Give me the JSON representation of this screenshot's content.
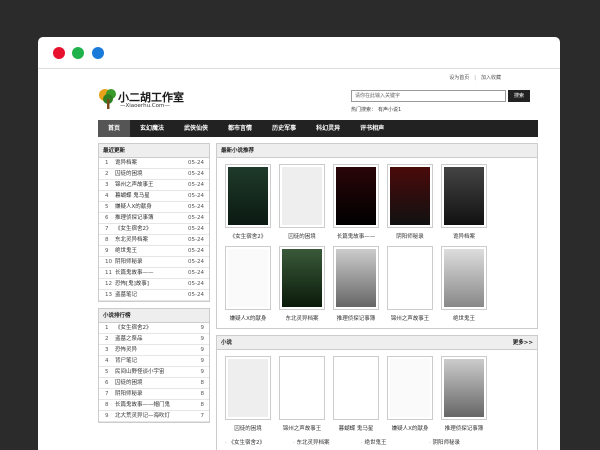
{
  "window": {
    "controls": [
      "close",
      "minimize",
      "maximize"
    ]
  },
  "toplinks": {
    "home": "设为首页",
    "sep": "|",
    "fav": "加入收藏"
  },
  "logo": {
    "cn": "小二胡工作室",
    "en": "—Xiaoerhu.Com—"
  },
  "search": {
    "placeholder": "请你在此输入关键字",
    "button": "搜索",
    "hot_label": "热门搜索：",
    "hot_link": "有声小说1"
  },
  "nav": [
    "首页",
    "玄幻魔法",
    "武侠仙侠",
    "都市言情",
    "历史军事",
    "科幻灵异",
    "评书相声"
  ],
  "latest": {
    "title": "最近更新",
    "items": [
      {
        "t": "诡异档案",
        "d": "05-24"
      },
      {
        "t": "囚徒的困境",
        "d": "05-24"
      },
      {
        "t": "锦州之声故事王",
        "d": "05-24"
      },
      {
        "t": "暮蝴蝶 鬼马星",
        "d": "05-24"
      },
      {
        "t": "嫌疑人X的献身",
        "d": "05-24"
      },
      {
        "t": "推理侦探记事簿",
        "d": "05-24"
      },
      {
        "t": "《女生宿舍2》",
        "d": "05-24"
      },
      {
        "t": "东北灵异档案",
        "d": "05-24"
      },
      {
        "t": "绝世鬼王",
        "d": "05-24"
      },
      {
        "t": "阴阳师秘录",
        "d": "05-24"
      },
      {
        "t": "长篇鬼故事——",
        "d": "05-24"
      },
      {
        "t": "恐怖[鬼]故事]",
        "d": "05-24"
      },
      {
        "t": "盗墓笔记",
        "d": "05-24"
      }
    ]
  },
  "ranking": {
    "title": "小说排行榜",
    "items": [
      {
        "n": "1",
        "t": "《女生宿舍2》",
        "v": "9"
      },
      {
        "n": "2",
        "t": "盗墓之祭品",
        "v": "9"
      },
      {
        "n": "3",
        "t": "恐怖灵异",
        "v": "9"
      },
      {
        "n": "4",
        "t": "背尸笔记",
        "v": "9"
      },
      {
        "n": "5",
        "t": "民间山野怪谈小宇宙",
        "v": "9"
      },
      {
        "n": "6",
        "t": "囚徒的困境",
        "v": "8"
      },
      {
        "n": "7",
        "t": "阴阳师秘录",
        "v": "8"
      },
      {
        "n": "8",
        "t": "长篇鬼故事——帽门鬼",
        "v": "8"
      },
      {
        "n": "9",
        "t": "北大荒灵异记—海吹灯",
        "v": "7"
      }
    ]
  },
  "recommended": {
    "title": "最新小说推荐",
    "books": [
      "《女生宿舍2》",
      "囚徒的困境",
      "长篇鬼故事——",
      "阴阳师秘录",
      "诡异档案",
      "嫌疑人X的献身",
      "东北灵异档案",
      "推理侦探记事簿",
      "锦州之声故事王",
      "绝世鬼王"
    ]
  },
  "novels": {
    "title": "小说",
    "more": "更多>>",
    "books": [
      "囚徒的困境",
      "锦州之声故事王",
      "暮蝴蝶 鬼马星",
      "嫌疑人X的献身",
      "推理侦探记事簿"
    ],
    "links": [
      "《女生宿舍2》",
      "东北灵异档案",
      "绝世鬼王",
      "阴阳师秘录",
      "长篇鬼故事——",
      "恐怖[鬼]故事]",
      "盗墓笔记",
      "微凉讲异"
    ]
  }
}
